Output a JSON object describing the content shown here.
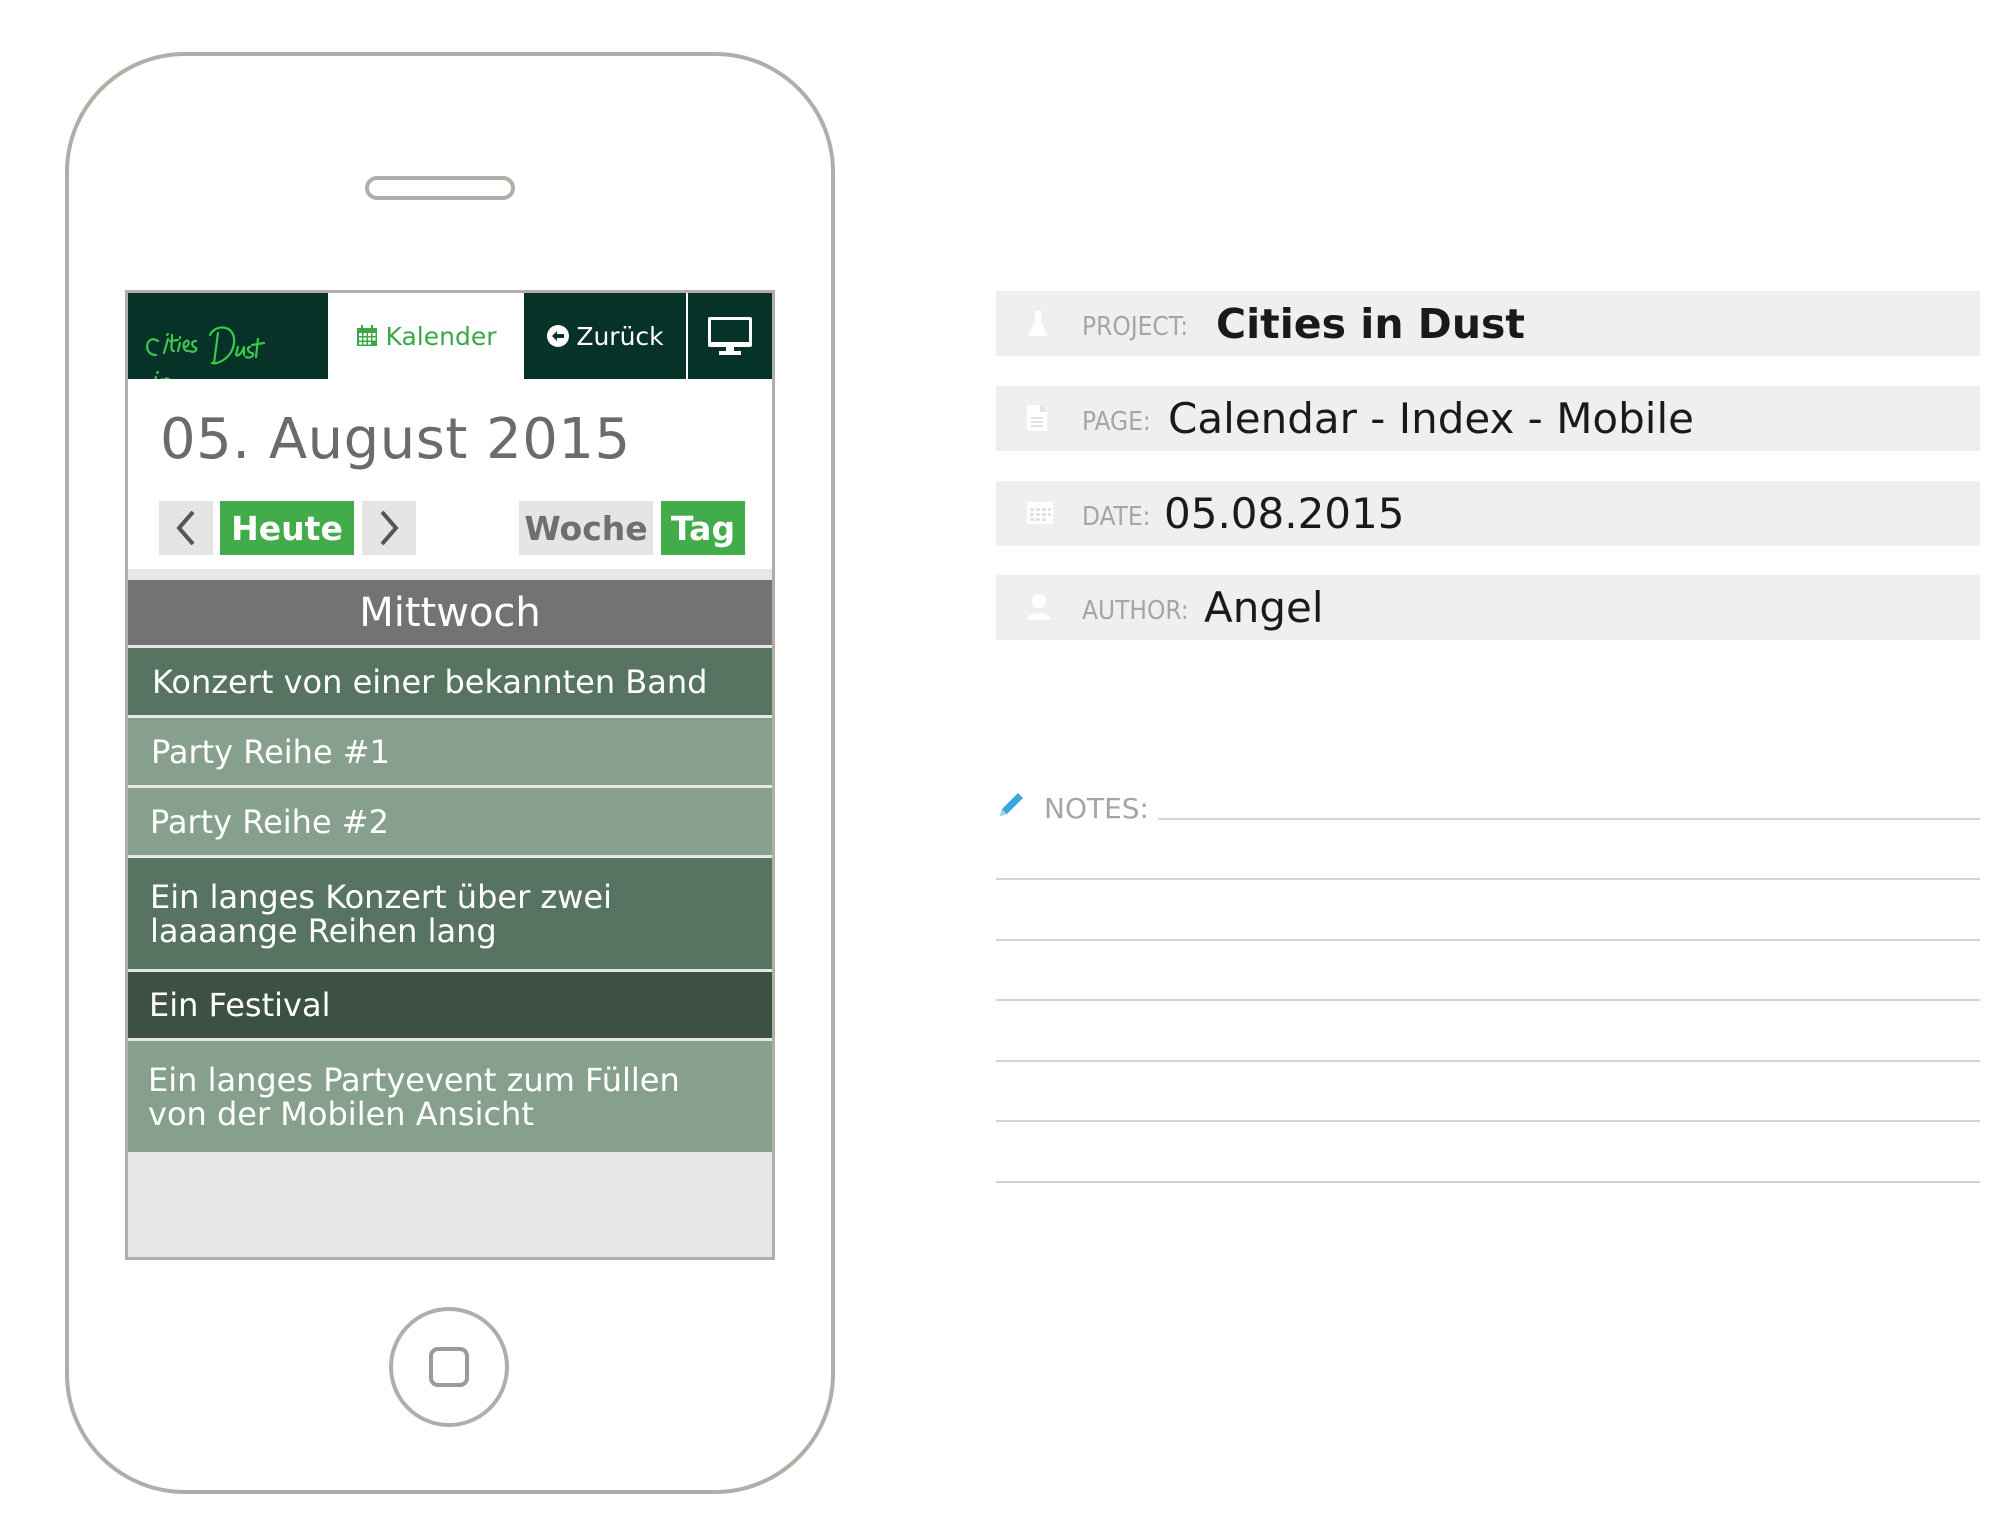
{
  "phone": {
    "app": {
      "logo_text_line1": "Cities",
      "logo_text_line2": "in Dust",
      "nav": {
        "calendar_label": "Kalender",
        "back_label": "Zurück"
      },
      "date_title": "05. August 2015",
      "controls": {
        "prev_icon": "chevron-left-icon",
        "today_label": "Heute",
        "next_icon": "chevron-right-icon",
        "week_label": "Woche",
        "day_label": "Tag"
      },
      "day_header": "Mittwoch",
      "events": [
        {
          "title": "Konzert von einer bekannten Band",
          "color": "#577361"
        },
        {
          "title": "Party Reihe #1",
          "color": "#86a08d"
        },
        {
          "title": "Party Reihe #2",
          "color": "#86a08d"
        },
        {
          "title": "Ein langes Konzert über zwei laaaange Reihen lang",
          "color": "#577361"
        },
        {
          "title": "Ein Festival",
          "color": "#3c5044"
        },
        {
          "title": "Ein langes Partyevent zum Füllen von der Mobilen Ansicht",
          "color": "#86a08d"
        }
      ]
    }
  },
  "meta": {
    "project_label": "PROJECT:",
    "project_value": "Cities in Dust",
    "page_label": "PAGE:",
    "page_value": "Calendar - Index - Mobile",
    "date_label": "DATE:",
    "date_value": "05.08.2015",
    "author_label": "AUTHOR:",
    "author_value": "Angel",
    "notes_label": "NOTES:"
  },
  "colors": {
    "brand_dark": "#063228",
    "brand_green": "#42ac4a",
    "neon_green": "#3cc84a",
    "accent_blue": "#3aa8e0"
  }
}
